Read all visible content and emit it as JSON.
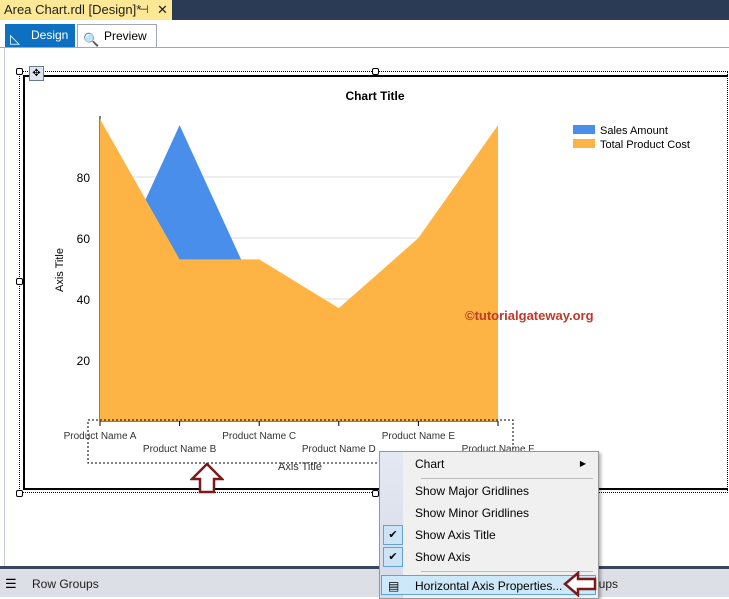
{
  "document_tab": {
    "title": "Area Chart.rdl [Design]*",
    "pin_icon": "pin-icon",
    "close_icon": "close-icon"
  },
  "view_tabs": [
    {
      "label": "Design",
      "active": true
    },
    {
      "label": "Preview",
      "active": false
    }
  ],
  "chart_data": {
    "type": "area",
    "title": "Chart Title",
    "xlabel": "Axis Title",
    "ylabel": "Axis Title",
    "categories": [
      "Product Name A",
      "Product Name B",
      "Product Name C",
      "Product Name D",
      "Product Name E",
      "Product Name F"
    ],
    "series": [
      {
        "name": "Sales Amount",
        "color": "#4a8eeb",
        "values": [
          40,
          97,
          40,
          25,
          45,
          80
        ]
      },
      {
        "name": "Total Product Cost",
        "color": "#fdb444",
        "values": [
          99,
          53,
          53,
          37,
          60,
          97
        ]
      }
    ],
    "yticks": [
      20,
      40,
      60,
      80
    ],
    "ylim": [
      0,
      100
    ],
    "grid": true,
    "legend": "top-right"
  },
  "watermark": "©tutorialgateway.org",
  "context_menu": {
    "items": [
      {
        "label": "Chart",
        "submenu": true
      },
      {
        "label": "Show Major Gridlines",
        "checked": false
      },
      {
        "label": "Show Minor Gridlines",
        "checked": false
      },
      {
        "label": "Show Axis Title",
        "checked": true
      },
      {
        "label": "Show Axis",
        "checked": true
      },
      {
        "label": "Horizontal Axis Properties...",
        "highlighted": true
      }
    ]
  },
  "bottom_panel": {
    "row_groups": "Row Groups",
    "column_groups": "Column Groups",
    "column_groups_visible": "oups"
  },
  "colors": {
    "accent": "#0e70c0",
    "callout": "#7b1a1a"
  }
}
